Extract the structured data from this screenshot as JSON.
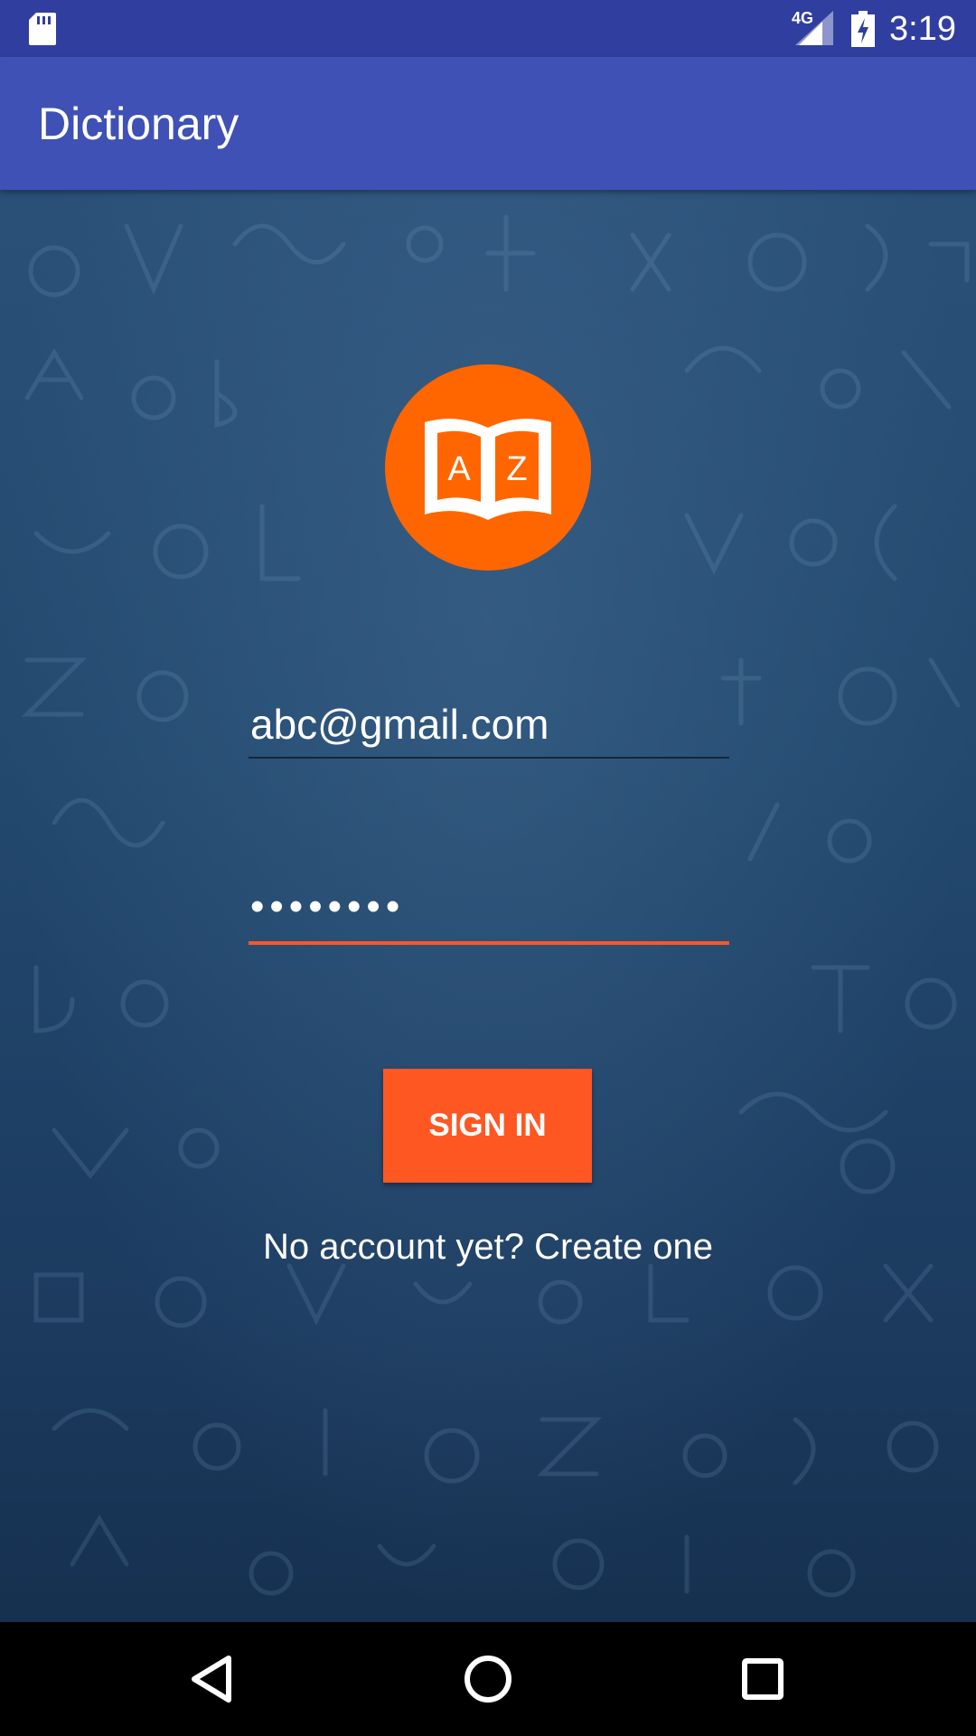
{
  "status_bar": {
    "network_label": "4G",
    "time": "3:19",
    "icons": [
      "sd-card-icon",
      "signal-icon",
      "battery-charging-icon"
    ]
  },
  "app_bar": {
    "title": "Dictionary"
  },
  "logo": {
    "icon": "dictionary-book-icon",
    "letter_left": "A",
    "letter_right": "Z",
    "color": "#ff6600"
  },
  "form": {
    "email_value": "abc@gmail.com",
    "password_value": "••••••••",
    "sign_in_label": "SIGN IN",
    "create_account_text": "No account yet? Create one"
  },
  "nav_bar": {
    "icons": [
      "back-icon",
      "home-icon",
      "recents-icon"
    ]
  },
  "colors": {
    "status_bar": "#303f9f",
    "app_bar": "#3f51b5",
    "accent": "#ff5722",
    "background": "#23496f"
  }
}
